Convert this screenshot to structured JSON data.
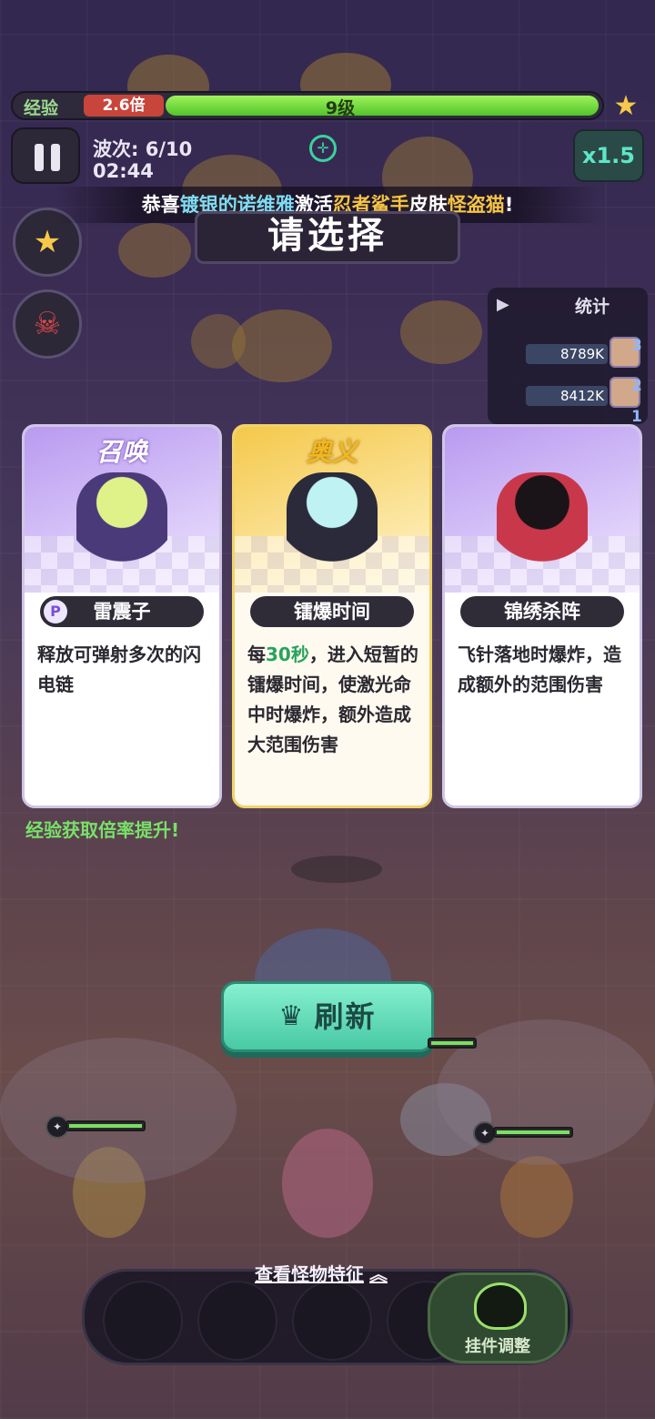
{
  "hud": {
    "xp_label": "经验",
    "xp_multiplier": "2.6倍",
    "level": "9级",
    "xp_progress": 1.0,
    "wave": "波次: 6/10",
    "timer": "02:44",
    "speed": "x1.5"
  },
  "banner": {
    "prefix": "恭喜",
    "player": "镀银的诺维雅",
    "verb": "激活",
    "skin_prefix": "忍者鲨手",
    "skin_word": "皮肤",
    "skin_name": "怪盗猫",
    "suffix": "!"
  },
  "title": "请选择",
  "stats": {
    "title": "统计",
    "rows": [
      {
        "value": "8789K",
        "rank": "3"
      },
      {
        "value": "8412K",
        "rank": "2"
      },
      {
        "value": "",
        "rank": "1"
      }
    ]
  },
  "cards": [
    {
      "category": "召唤",
      "name": "雷震子",
      "name_icon": "P",
      "description": "释放可弹射多次的闪电链",
      "color": "#c9b4f2",
      "category_color": "#ffffff"
    },
    {
      "category": "奥义",
      "name": "镭爆时间",
      "description_before": "每",
      "description_hl": "30秒",
      "description_after": "，进入短暂的镭爆时间，使激光命中时爆炸，额外造成大范围伤害",
      "color": "#f7dd88",
      "category_color": "#f0b820"
    },
    {
      "category": "",
      "name": "锦绣杀阵",
      "description": "飞针落地时爆炸，造成额外的范围伤害",
      "color": "#c9b4f2",
      "category_color": "#ffffff"
    }
  ],
  "xp_boost": "经验获取倍率提升!",
  "refresh_label": "刷新",
  "monster_link": "查看怪物特征",
  "plugin_label": "挂件调整",
  "colors": {
    "accent_green": "#48c9a4",
    "xp_green": "#79e06a",
    "highlight_gold": "#f5c444",
    "highlight_cyan": "#7fdcf4"
  }
}
